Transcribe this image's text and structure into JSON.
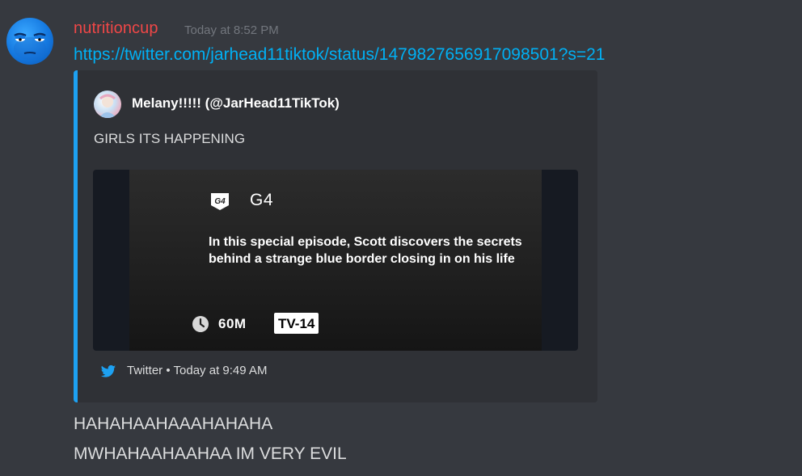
{
  "message": {
    "username": "nutritioncup",
    "timestamp": "Today at 8:52 PM",
    "link": "https://twitter.com/jarhead11tiktok/status/1479827656917098501?s=21",
    "lines": [
      "HAHAHAAHAAAHAHAHA",
      "MWHAHAAHAAHAA IM VERY EVIL"
    ]
  },
  "embed": {
    "author": "Melany!!!!! (@JarHead11TikTok)",
    "description": "GIRLS ITS HAPPENING",
    "image": {
      "network": "G4",
      "logo_text": "G4",
      "episode_description": "In this special episode, Scott discovers the secrets behind a strange blue border closing in on his life",
      "duration": "60M",
      "rating": "TV-14"
    },
    "footer": {
      "source": "Twitter",
      "separator": "•",
      "time": "Today at 9:49 AM"
    },
    "accent_color": "#1da1f2"
  },
  "colors": {
    "background": "#36393f",
    "username": "#f04747",
    "link": "#00b0f4",
    "embed_bg": "#2f3136"
  },
  "icons": {
    "avatar": "blue-smiley-avatar",
    "footer": "twitter-bird-icon",
    "clock": "clock-icon",
    "logo": "g4-logo-icon"
  }
}
